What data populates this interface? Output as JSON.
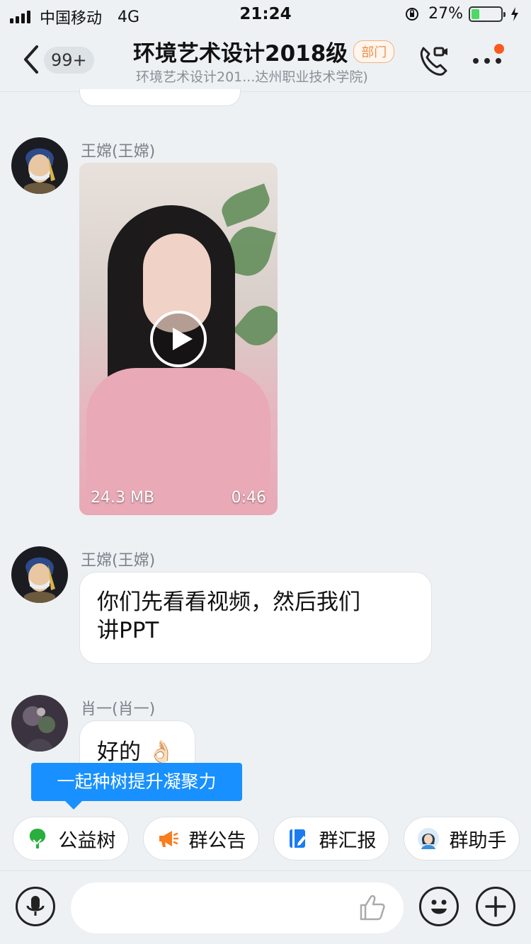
{
  "status_bar": {
    "carrier": "中国移动",
    "network": "4G",
    "time": "21:24",
    "battery": "27%",
    "battery_level": 0.27
  },
  "header": {
    "unread_count": "99+",
    "title": "环境艺术设计2018级",
    "tag": "部门",
    "subtitle": "环境艺术设计201...达州职业技术学院)"
  },
  "messages": [
    {
      "sender": "王嫦(王嫦)",
      "type": "video",
      "file_size": "24.3 MB",
      "duration": "0:46"
    },
    {
      "sender": "王嫦(王嫦)",
      "type": "text",
      "lines": [
        "你们先看看视频，然后我们",
        "讲PPT"
      ]
    },
    {
      "sender": "肖一(肖一)",
      "type": "text",
      "text": "好的",
      "emoji": "👌🏻"
    }
  ],
  "tooltip": "一起种树提升凝聚力",
  "quick_actions": [
    {
      "label": "公益树",
      "icon": "tree-icon",
      "color": "#2aae3e"
    },
    {
      "label": "群公告",
      "icon": "megaphone-icon",
      "color": "#fa7d1e"
    },
    {
      "label": "群汇报",
      "icon": "report-icon",
      "color": "#1a7cf0"
    },
    {
      "label": "群助手",
      "icon": "assistant-avatar-icon",
      "color": "#3a8fd8"
    }
  ],
  "colors": {
    "background": "#edf1f4",
    "accent": "#1890ff",
    "tag_orange": "#ef8f46",
    "notification_dot": "#fa5a1d"
  }
}
